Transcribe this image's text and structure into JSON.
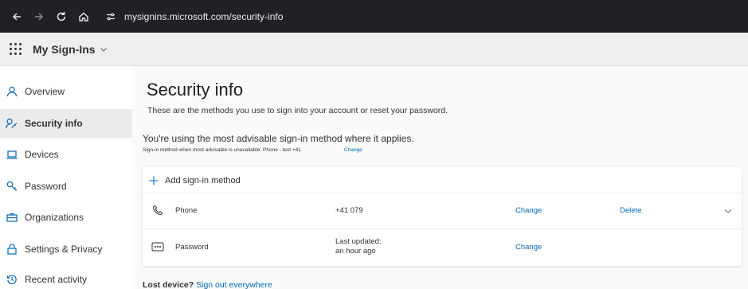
{
  "browser": {
    "url": "mysignins.microsoft.com/security-info"
  },
  "header": {
    "app_title": "My Sign-Ins"
  },
  "sidebar": {
    "items": [
      {
        "label": "Overview",
        "icon": "person-icon",
        "active": false
      },
      {
        "label": "Security info",
        "icon": "security-info-icon",
        "active": true
      },
      {
        "label": "Devices",
        "icon": "laptop-icon",
        "active": false
      },
      {
        "label": "Password",
        "icon": "key-icon",
        "active": false
      },
      {
        "label": "Organizations",
        "icon": "briefcase-icon",
        "active": false
      },
      {
        "label": "Settings & Privacy",
        "icon": "lock-icon",
        "active": false
      },
      {
        "label": "Recent activity",
        "icon": "history-icon",
        "active": false
      }
    ]
  },
  "main": {
    "title": "Security info",
    "subtitle": "These are the methods you use to sign into your account or reset your password.",
    "advisable": "You're using the most advisable sign-in method where it applies.",
    "advisable_sub": "Sign-in method when most advisable is unavailable: Phone - text +41",
    "advisable_change": "Change",
    "add_method_label": "Add sign-in method",
    "methods": [
      {
        "name": "Phone",
        "detail_line1": "+41 079",
        "detail_line2": "",
        "change": "Change",
        "delete": "Delete",
        "icon": "phone-icon"
      },
      {
        "name": "Password",
        "detail_line1": "Last updated:",
        "detail_line2": "an hour ago",
        "change": "Change",
        "delete": "",
        "icon": "password-dots-icon"
      }
    ],
    "lost_device_label": "Lost device?",
    "sign_out_everywhere": "Sign out everywhere"
  },
  "colors": {
    "accent": "#0067b8",
    "browser_bar": "#202124",
    "header_bg": "#eeeeee",
    "active_item_bg": "#ebebeb"
  }
}
